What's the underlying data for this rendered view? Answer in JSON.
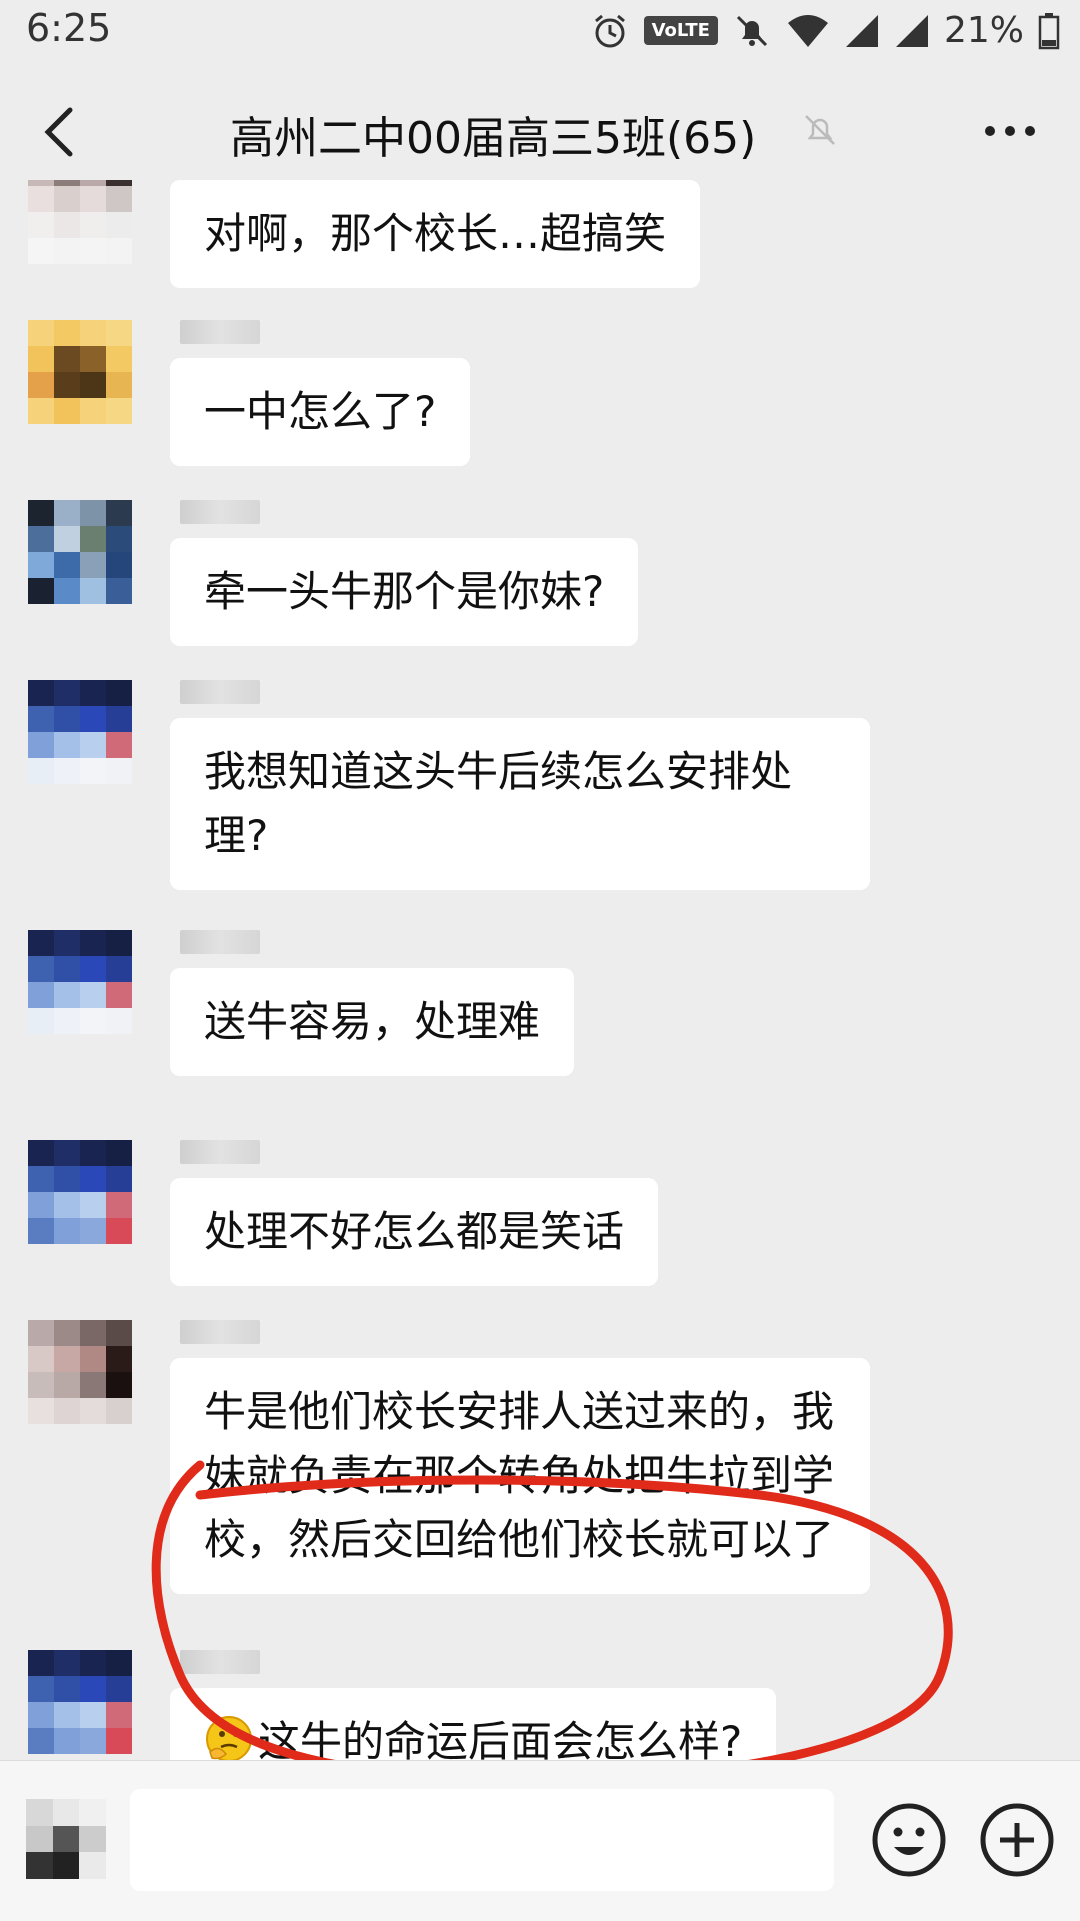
{
  "status_bar": {
    "time": "6:25",
    "volte": "VoLTE",
    "battery": "21%"
  },
  "header": {
    "title": "高州二中00届高三5班(65)"
  },
  "messages": [
    {
      "text": "对啊，那个校长…超搞笑"
    },
    {
      "text": "一中怎么了?"
    },
    {
      "text": "牵一头牛那个是你妹?"
    },
    {
      "text": "我想知道这头牛后续怎么安排处理?"
    },
    {
      "text": "送牛容易，处理难"
    },
    {
      "text": "处理不好怎么都是笑话"
    },
    {
      "text": "牛是他们校长安排人送过来的，我妹就负责在那个转角处把牛拉到学校，然后交回给他们校长就可以了"
    },
    {
      "text": "这牛的命运后面会怎么样?",
      "emoji": "thinking-face-icon"
    }
  ],
  "annotation_color": "#e02a1a",
  "icons": [
    "back-arrow-icon",
    "mute-bell-icon",
    "more-icon",
    "voice-icon",
    "emoji-icon",
    "plus-icon"
  ]
}
